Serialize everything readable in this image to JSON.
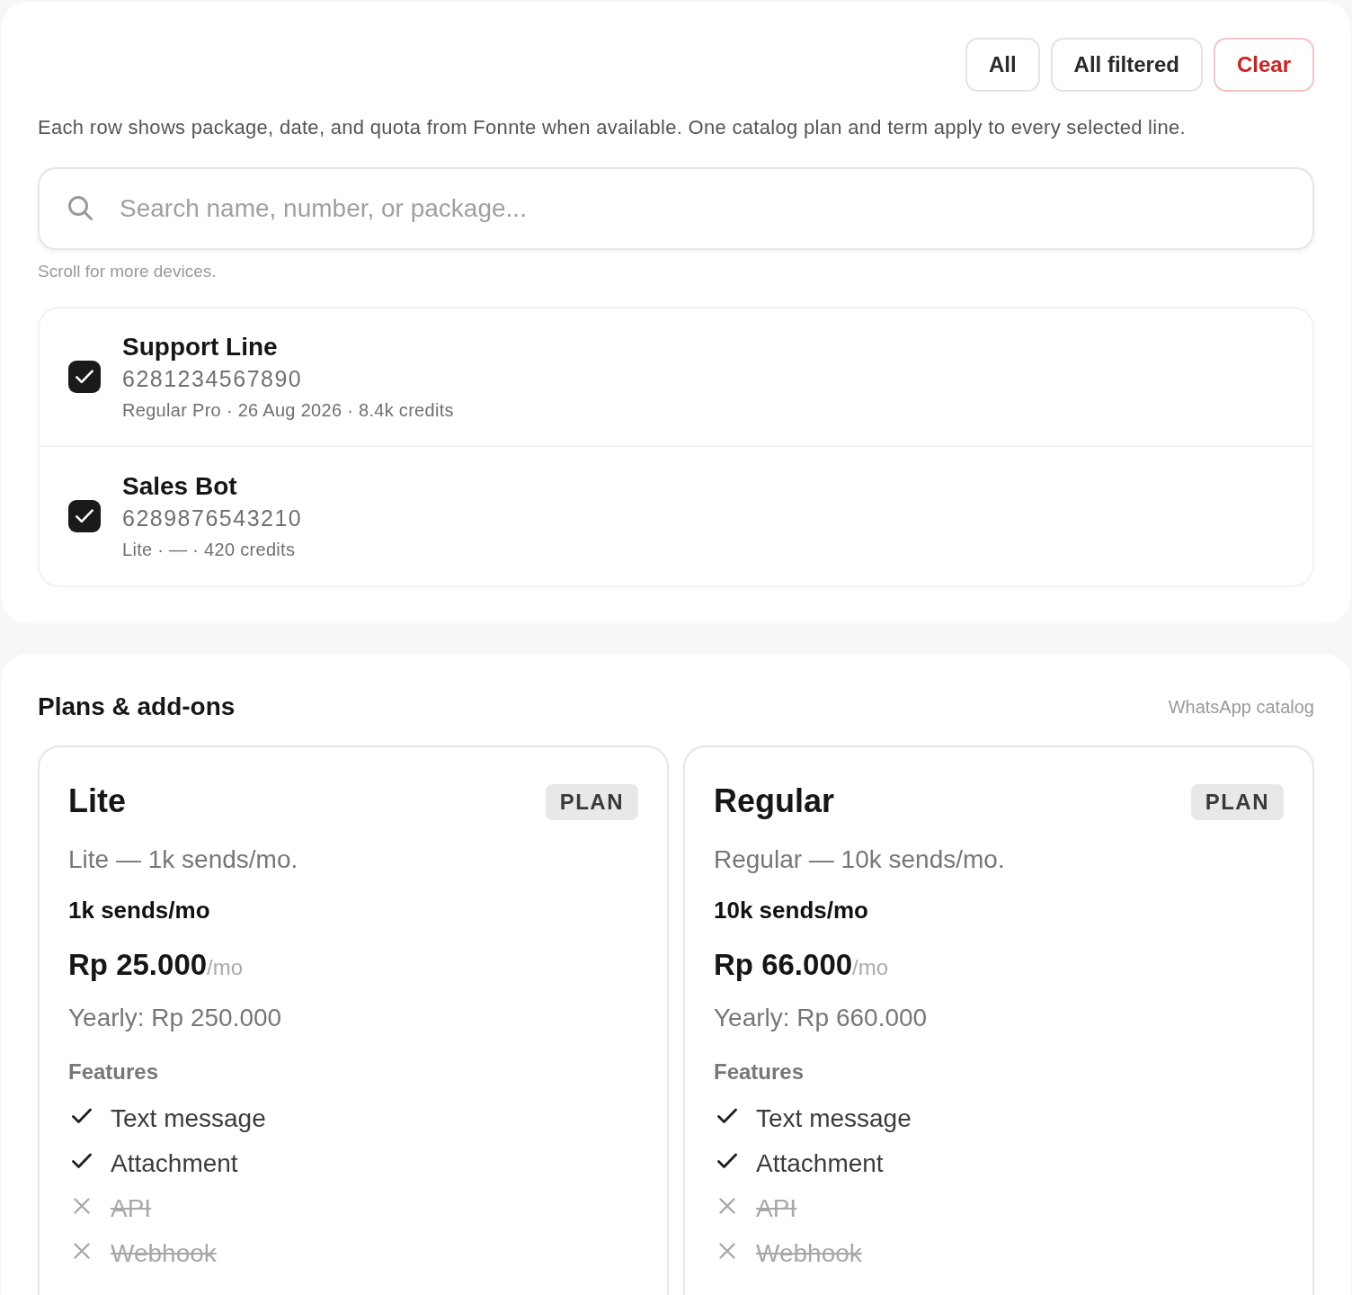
{
  "toolbar": {
    "buttons": [
      {
        "label": "All",
        "kind": "default"
      },
      {
        "label": "All filtered",
        "kind": "default"
      },
      {
        "label": "Clear",
        "kind": "danger"
      }
    ]
  },
  "description": "Each row shows package, date, and quota from Fonnte when available. One catalog plan and term apply to every selected line.",
  "search": {
    "placeholder": "Search name, number, or package..."
  },
  "hint": "Scroll for more devices.",
  "devices": [
    {
      "name": "Support Line",
      "number": "6281234567890",
      "details": "Regular Pro · 26 Aug 2026 · 8.4k credits",
      "checked": true
    },
    {
      "name": "Sales Bot",
      "number": "6289876543210",
      "details": "Lite · — · 420 credits",
      "checked": true
    }
  ],
  "plans_section": {
    "title": "Plans & add-ons",
    "subtitle": "WhatsApp catalog",
    "plans": [
      {
        "name": "Lite",
        "badge": "PLAN",
        "description": "Lite — 1k sends/mo.",
        "quota": "1k sends/mo",
        "price": "Rp 25.000",
        "period": "/mo",
        "yearly": "Yearly: Rp 250.000",
        "features_label": "Features",
        "features": [
          {
            "label": "Text message",
            "included": true
          },
          {
            "label": "Attachment",
            "included": true
          },
          {
            "label": "API",
            "included": false
          },
          {
            "label": "Webhook",
            "included": false
          }
        ]
      },
      {
        "name": "Regular",
        "badge": "PLAN",
        "description": "Regular — 10k sends/mo.",
        "quota": "10k sends/mo",
        "price": "Rp 66.000",
        "period": "/mo",
        "yearly": "Yearly: Rp 660.000",
        "features_label": "Features",
        "features": [
          {
            "label": "Text message",
            "included": true
          },
          {
            "label": "Attachment",
            "included": true
          },
          {
            "label": "API",
            "included": false
          },
          {
            "label": "Webhook",
            "included": false
          }
        ]
      }
    ]
  }
}
